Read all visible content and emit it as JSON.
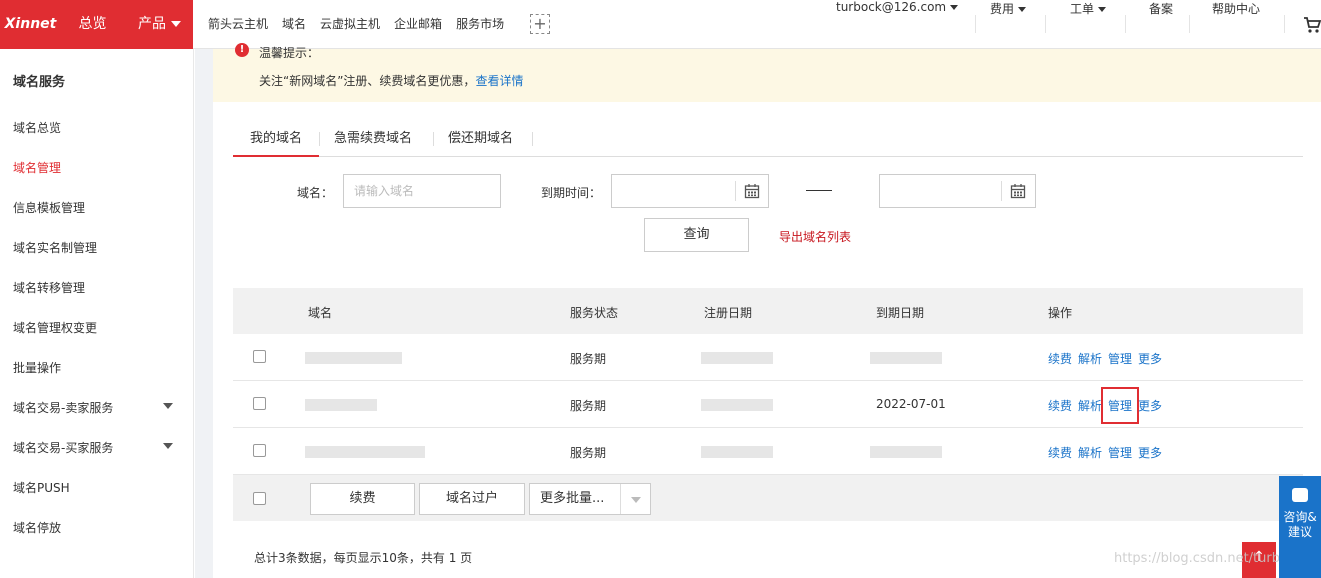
{
  "topbar": {
    "logo": "Xinnet",
    "home": "总览",
    "products": "产品",
    "links": [
      "箭头云主机",
      "域名",
      "云虚拟主机",
      "企业邮箱",
      "服务市场"
    ],
    "account": "turbock@126.com",
    "fees": "费用",
    "tickets": "工单",
    "filing": "备案",
    "help": "帮助中心"
  },
  "sidebar": {
    "title": "域名服务",
    "items": [
      {
        "label": "域名总览"
      },
      {
        "label": "域名管理"
      },
      {
        "label": "信息模板管理"
      },
      {
        "label": "域名实名制管理"
      },
      {
        "label": "域名转移管理"
      },
      {
        "label": "域名管理权变更"
      },
      {
        "label": "批量操作"
      },
      {
        "label": "域名交易-卖家服务"
      },
      {
        "label": "域名交易-买家服务"
      },
      {
        "label": "域名PUSH"
      },
      {
        "label": "域名停放"
      }
    ]
  },
  "notice": {
    "title": "温馨提示：",
    "text": "关注“新网域名”注册、续费域名更优惠，",
    "link": "查看详情"
  },
  "tabs": [
    "我的域名",
    "急需续费域名",
    "偿还期域名"
  ],
  "filter": {
    "domain_label": "域名：",
    "domain_placeholder": "请输入域名",
    "expire_label": "到期时间：",
    "query": "查询",
    "export": "导出域名列表"
  },
  "table": {
    "headers": [
      "域名",
      "服务状态",
      "注册日期",
      "到期日期",
      "操作"
    ],
    "rows": [
      {
        "status": "服务期",
        "expire": ""
      },
      {
        "status": "服务期",
        "expire": "2022-07-01"
      },
      {
        "status": "服务期",
        "expire": ""
      }
    ],
    "actions": [
      "续费",
      "解析",
      "管理",
      "更多"
    ]
  },
  "bulk": {
    "renew": "续费",
    "transfer": "域名过户",
    "more": "更多批量..."
  },
  "pager": "总计3条数据，每页显示10条，共有 1 页",
  "float": {
    "consult": "咨询&建议",
    "totop": "↑"
  },
  "watermark": "https://blog.csdn.net/turbock"
}
